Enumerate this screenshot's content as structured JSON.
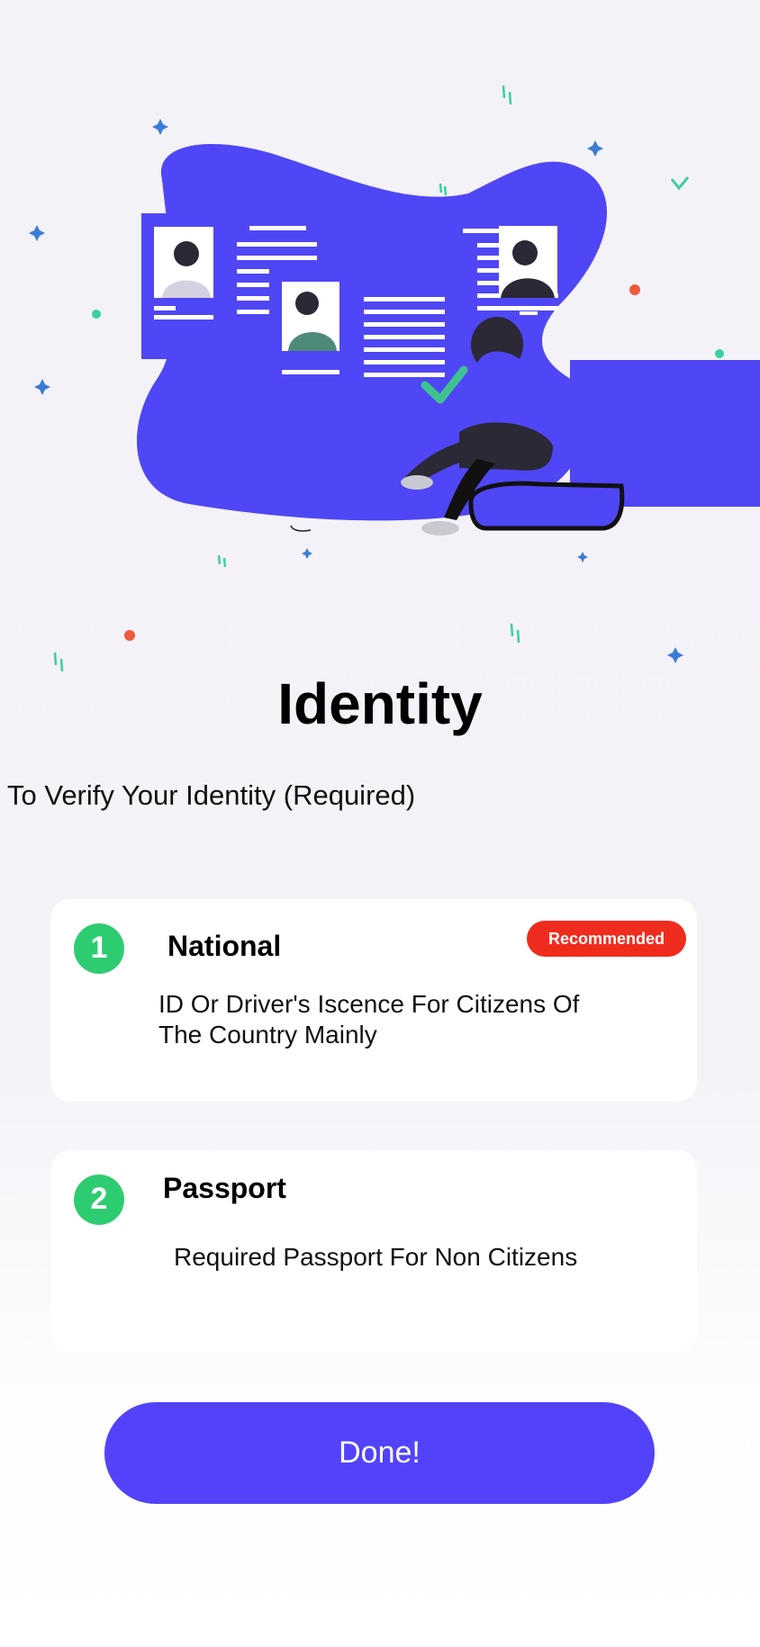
{
  "page": {
    "title": "Identity",
    "subtitle": "To Verify Your Identity (Required)"
  },
  "options": [
    {
      "number": "1",
      "title": "National",
      "badge": "Recommended",
      "description": "ID Or Driver's Iscence For Citizens Of The Country Mainly"
    },
    {
      "number": "2",
      "title": "Passport",
      "description": "Required Passport For Non Citizens"
    }
  ],
  "done_button": {
    "label": "Done!"
  },
  "colors": {
    "accent": "#5243fa",
    "step_badge": "#2ecc71",
    "recommended": "#f02c1e",
    "background": "#f3f2f7"
  },
  "illustration": {
    "subject": "person sitting beside identity documents with a check mark",
    "icons": [
      "document-card-icon",
      "check-icon",
      "sparkle-icon"
    ]
  }
}
